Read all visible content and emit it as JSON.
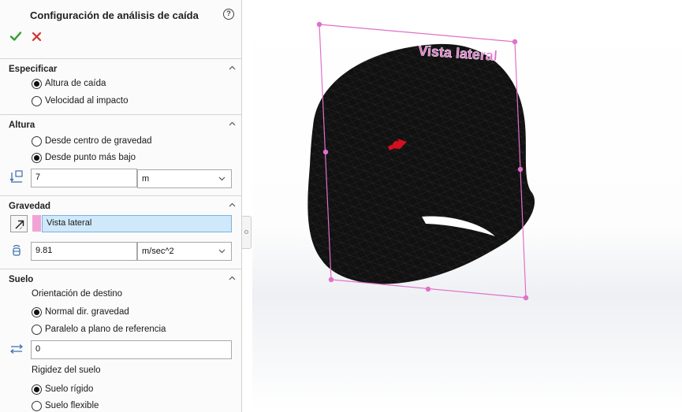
{
  "panel": {
    "title": "Configuración de análisis de caída",
    "help_icon": "?",
    "confirm_icon": "check-icon",
    "cancel_icon": "close-icon"
  },
  "specify": {
    "title": "Especificar",
    "options": [
      {
        "label": "Altura de caída",
        "checked": true
      },
      {
        "label": "Velocidad al impacto",
        "checked": false
      }
    ]
  },
  "height": {
    "title": "Altura",
    "options": [
      {
        "label": "Desde centro de gravedad",
        "checked": false
      },
      {
        "label": "Desde punto más bajo",
        "checked": true
      }
    ],
    "value": "7",
    "unit": "m"
  },
  "gravity": {
    "title": "Gravedad",
    "reference": "Vista lateral",
    "value": "9.81",
    "unit": "m/sec^2"
  },
  "floor": {
    "title": "Suelo",
    "orientation_label": "Orientación de destino",
    "orientation_options": [
      {
        "label": "Normal dir. gravedad",
        "checked": true
      },
      {
        "label": "Paralelo a plano de referencia",
        "checked": false
      }
    ],
    "offset_value": "0",
    "stiffness_label": "Rigidez del suelo",
    "stiffness_options": [
      {
        "label": "Suelo rígido",
        "checked": true
      },
      {
        "label": "Suelo flexible",
        "checked": false
      }
    ]
  },
  "viewport": {
    "plane_label": "Vista lateral",
    "plane_color": "#e070c8",
    "model_color": "#111111",
    "arrow_color": "#d41020"
  }
}
